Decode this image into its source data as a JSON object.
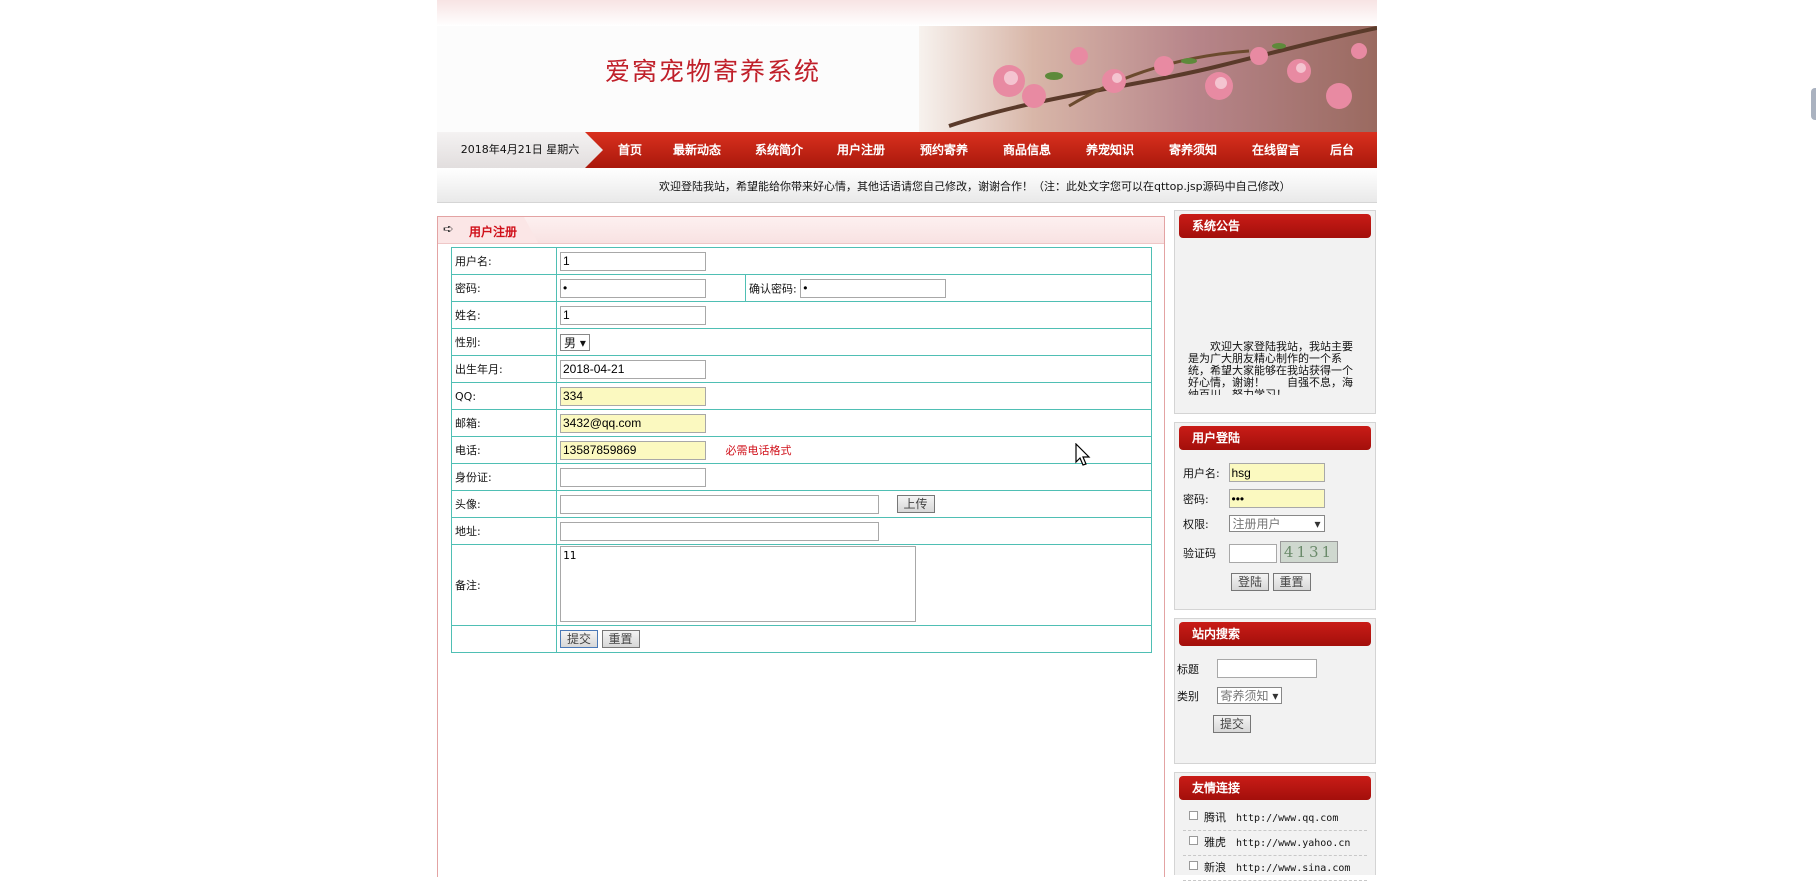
{
  "header": {
    "site_title": "爱窝宠物寄养系统",
    "date": "2018年4月21日 星期六",
    "nav": [
      "首页",
      "最新动态",
      "系统简介",
      "用户注册",
      "预约寄养",
      "商品信息",
      "养宠知识",
      "寄养须知",
      "在线留言",
      "后台"
    ],
    "welcome": "欢迎登陆我站，希望能给你带来好心情，其他话语请您自己修改，谢谢合作！（注：此处文字您可以在qttop.jsp源码中自己修改）"
  },
  "register": {
    "title": "用户注册",
    "username_label": "用户名:",
    "username_value": "1",
    "password_label": "密码:",
    "password_value": "•",
    "confirm_label": "确认密码:",
    "confirm_value": "•",
    "name_label": "姓名:",
    "name_value": "1",
    "gender_label": "性别:",
    "gender_value": "男",
    "birth_label": "出生年月:",
    "birth_value": "2018-04-21",
    "qq_label": "QQ:",
    "qq_value": "334",
    "email_label": "邮箱:",
    "email_value": "3432@qq.com",
    "phone_label": "电话:",
    "phone_value": "13587859869",
    "phone_hint": "必需电话格式",
    "idcard_label": "身份证:",
    "idcard_value": "",
    "avatar_label": "头像:",
    "avatar_value": "",
    "upload_button": "上传",
    "address_label": "地址:",
    "address_value": "",
    "remark_label": "备注:",
    "remark_value": "11",
    "submit_button": "提交",
    "reset_button": "重置"
  },
  "sidebar": {
    "notice_title": "系统公告",
    "notice_text": "欢迎大家登陆我站，我站主要是为广大朋友精心制作的一个系统，希望大家能够在我站获得一个好心情，谢谢！　　自强不息，海纳百川，努力学习！",
    "login_title": "用户登陆",
    "login_user_label": "用户名:",
    "login_user_value": "hsg",
    "login_pwd_label": "密码:",
    "login_pwd_value": "•••",
    "login_role_label": "权限:",
    "login_role_value": "注册用户",
    "login_code_label": "验证码",
    "captcha_text": "4131",
    "login_button": "登陆",
    "login_reset": "重置",
    "search_title": "站内搜索",
    "search_title_label": "标题",
    "search_type_label": "类别",
    "search_type_value": "寄养须知",
    "search_button": "提交",
    "links_title": "友情连接",
    "links": [
      {
        "name": "腾讯",
        "url": "http://www.qq.com"
      },
      {
        "name": "雅虎",
        "url": "http://www.yahoo.cn"
      },
      {
        "name": "新浪",
        "url": "http://www.sina.com"
      }
    ]
  },
  "colors": {
    "accent": "#c91c17",
    "table_border": "#4fbfb4",
    "highlight_input": "#fbf9c0"
  }
}
